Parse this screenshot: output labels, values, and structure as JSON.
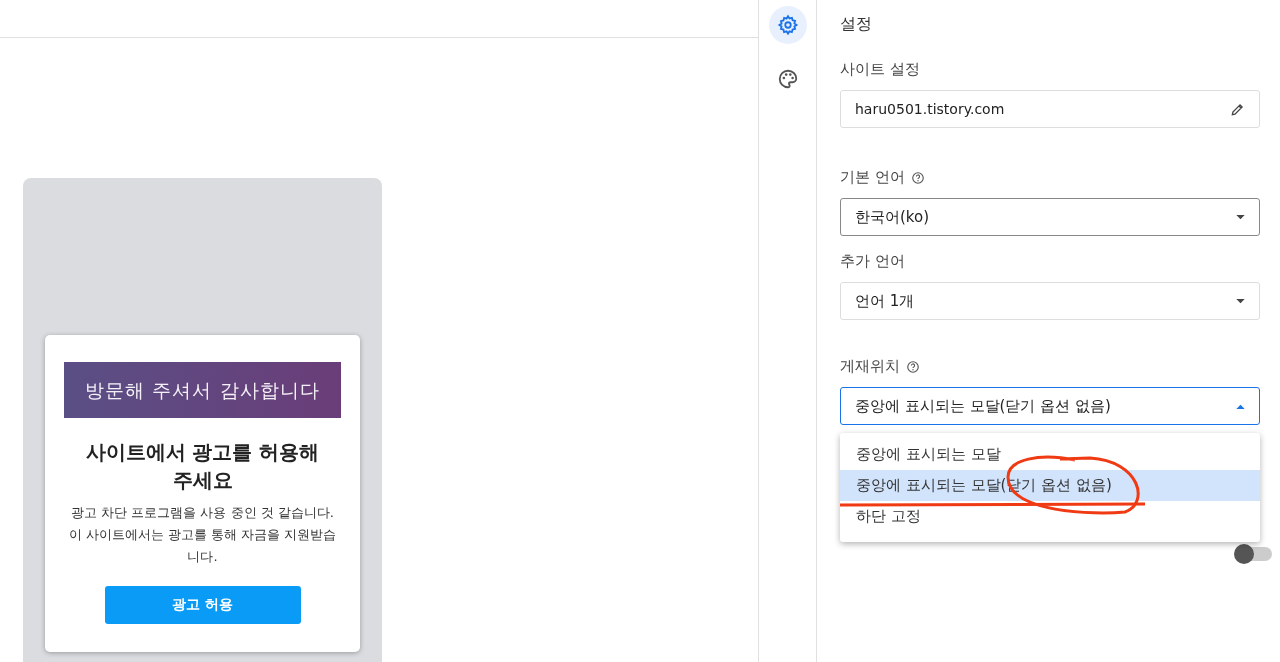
{
  "preview": {
    "banner": "방문해 주셔서 감사합니다",
    "title": "사이트에서 광고를 허용해 주세요",
    "body": "광고 차단 프로그램을 사용 중인 것 같습니다. 이 사이트에서는 광고를 통해 자금을 지원받습니다.",
    "button": "광고 허용"
  },
  "rail": [
    {
      "kind": "settings",
      "selected": true
    },
    {
      "kind": "palette",
      "selected": false
    }
  ],
  "panel": {
    "title": "설정",
    "site": {
      "label": "사이트 설정",
      "value": "haru0501.tistory.com"
    },
    "language": {
      "label": "기본 언어",
      "value": "한국어(ko)"
    },
    "extra_language": {
      "label": "추가 언어",
      "value": "언어 1개"
    },
    "placement": {
      "label": "게재위치",
      "value": "중앙에 표시되는 모달(닫기 옵션 없음)",
      "expanded": true,
      "options": [
        {
          "label": "중앙에 표시되는 모달",
          "selected": false
        },
        {
          "label": "중앙에 표시되는 모달(닫기 옵션 없음)",
          "selected": true
        },
        {
          "label": "하단 고정",
          "selected": false
        }
      ]
    },
    "toggle_row": {
      "on": false
    }
  }
}
